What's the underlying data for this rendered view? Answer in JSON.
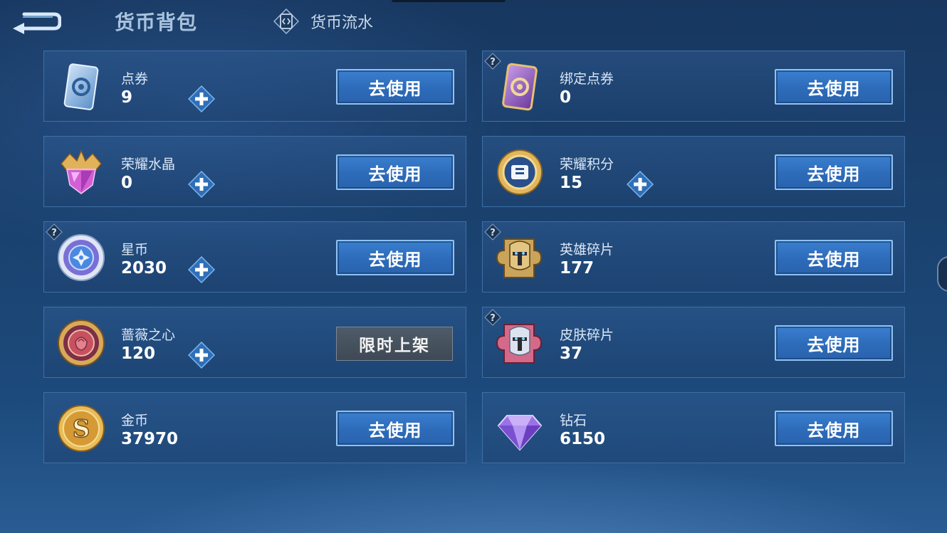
{
  "header": {
    "title": "货币背包",
    "flow_label": "货币流水"
  },
  "cards": {
    "dianquan": {
      "name": "点券",
      "amount": "9",
      "button": "去使用"
    },
    "bind_dianquan": {
      "name": "绑定点券",
      "amount": "0",
      "button": "去使用"
    },
    "crystal": {
      "name": "荣耀水晶",
      "amount": "0",
      "button": "去使用"
    },
    "points": {
      "name": "荣耀积分",
      "amount": "15",
      "button": "去使用"
    },
    "starcoin": {
      "name": "星币",
      "amount": "2030",
      "button": "去使用"
    },
    "hero_shard": {
      "name": "英雄碎片",
      "amount": "177",
      "button": "去使用"
    },
    "rose": {
      "name": "蔷薇之心",
      "amount": "120",
      "button": "限时上架"
    },
    "skin_shard": {
      "name": "皮肤碎片",
      "amount": "37",
      "button": "去使用"
    },
    "gold": {
      "name": "金币",
      "amount": "37970",
      "button": "去使用"
    },
    "diamond": {
      "name": "钻石",
      "amount": "6150",
      "button": "去使用"
    }
  },
  "icons": {
    "back": "back-arrow-icon",
    "flow": "currency-flow-icon",
    "plus": "plus-icon",
    "help": "question-mark-icon"
  },
  "colors": {
    "button_blue": "#2d6bb9",
    "button_border": "#8fc2f4",
    "disabled_gray": "#4f5b68",
    "card_border": "#3f6fa6"
  }
}
